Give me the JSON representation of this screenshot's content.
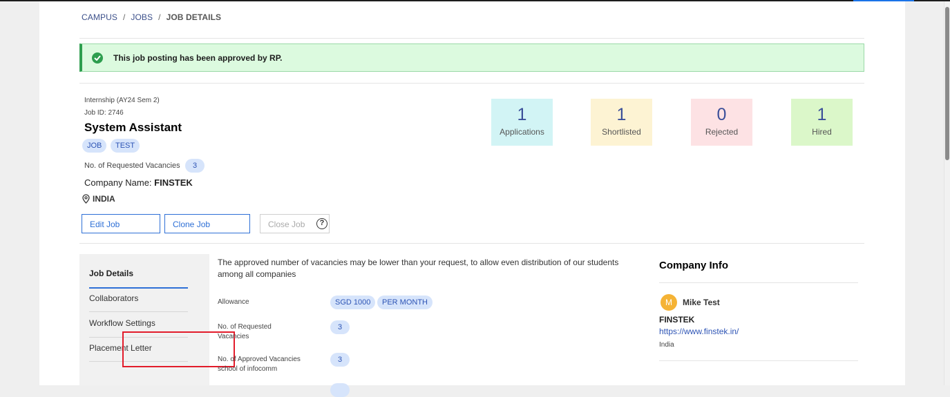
{
  "breadcrumb": {
    "items": [
      "CAMPUS",
      "JOBS"
    ],
    "current": "JOB DETAILS",
    "separator": "/"
  },
  "alert": {
    "message": "This job posting has been approved by RP.",
    "status": "success",
    "color": "#2e9e4f"
  },
  "job": {
    "type": "Internship (AY24 Sem 2)",
    "id_label": "Job ID: 2746",
    "title": "System Assistant",
    "tags": [
      "JOB",
      "TEST"
    ],
    "requested_vacancies_label": "No. of Requested Vacancies",
    "requested_vacancies": "3",
    "company_label": "Company Name:",
    "company_name": "FINSTEK",
    "location": "INDIA"
  },
  "actions": {
    "edit": "Edit Job",
    "clone": "Clone Job",
    "close": "Close Job",
    "close_help_icon": "question-circle-icon"
  },
  "stats": [
    {
      "value": "1",
      "label": "Applications",
      "color": "#d2f4f5"
    },
    {
      "value": "1",
      "label": "Shortlisted",
      "color": "#fdf3d3"
    },
    {
      "value": "0",
      "label": "Rejected",
      "color": "#fde2e4"
    },
    {
      "value": "1",
      "label": "Hired",
      "color": "#dbf7c9"
    }
  ],
  "sidebar": {
    "items": [
      "Job Details",
      "Collaborators",
      "Workflow Settings",
      "Placement Letter"
    ],
    "active": "Job Details",
    "highlighted": "Placement Letter"
  },
  "details": {
    "note": "The approved number of vacancies may be lower than your request, to allow even distribution of our students among all companies",
    "allowance_label": "Allowance",
    "allowance_amount": "SGD 1000",
    "allowance_period": "PER MONTH",
    "requested_vacancies_label_1": "No. of Requested",
    "requested_vacancies_label_2": "Vacancies",
    "requested_vacancies": "3",
    "approved_vacancies_label_1": "No. of Approved Vacancies",
    "approved_vacancies_label_2": "school of infocomm",
    "approved_vacancies": "3"
  },
  "company_info": {
    "title": "Company Info",
    "avatar_letter": "M",
    "contact_name": "Mike Test",
    "company": "FINSTEK",
    "url": "https://www.finstek.in/",
    "country": "India"
  }
}
